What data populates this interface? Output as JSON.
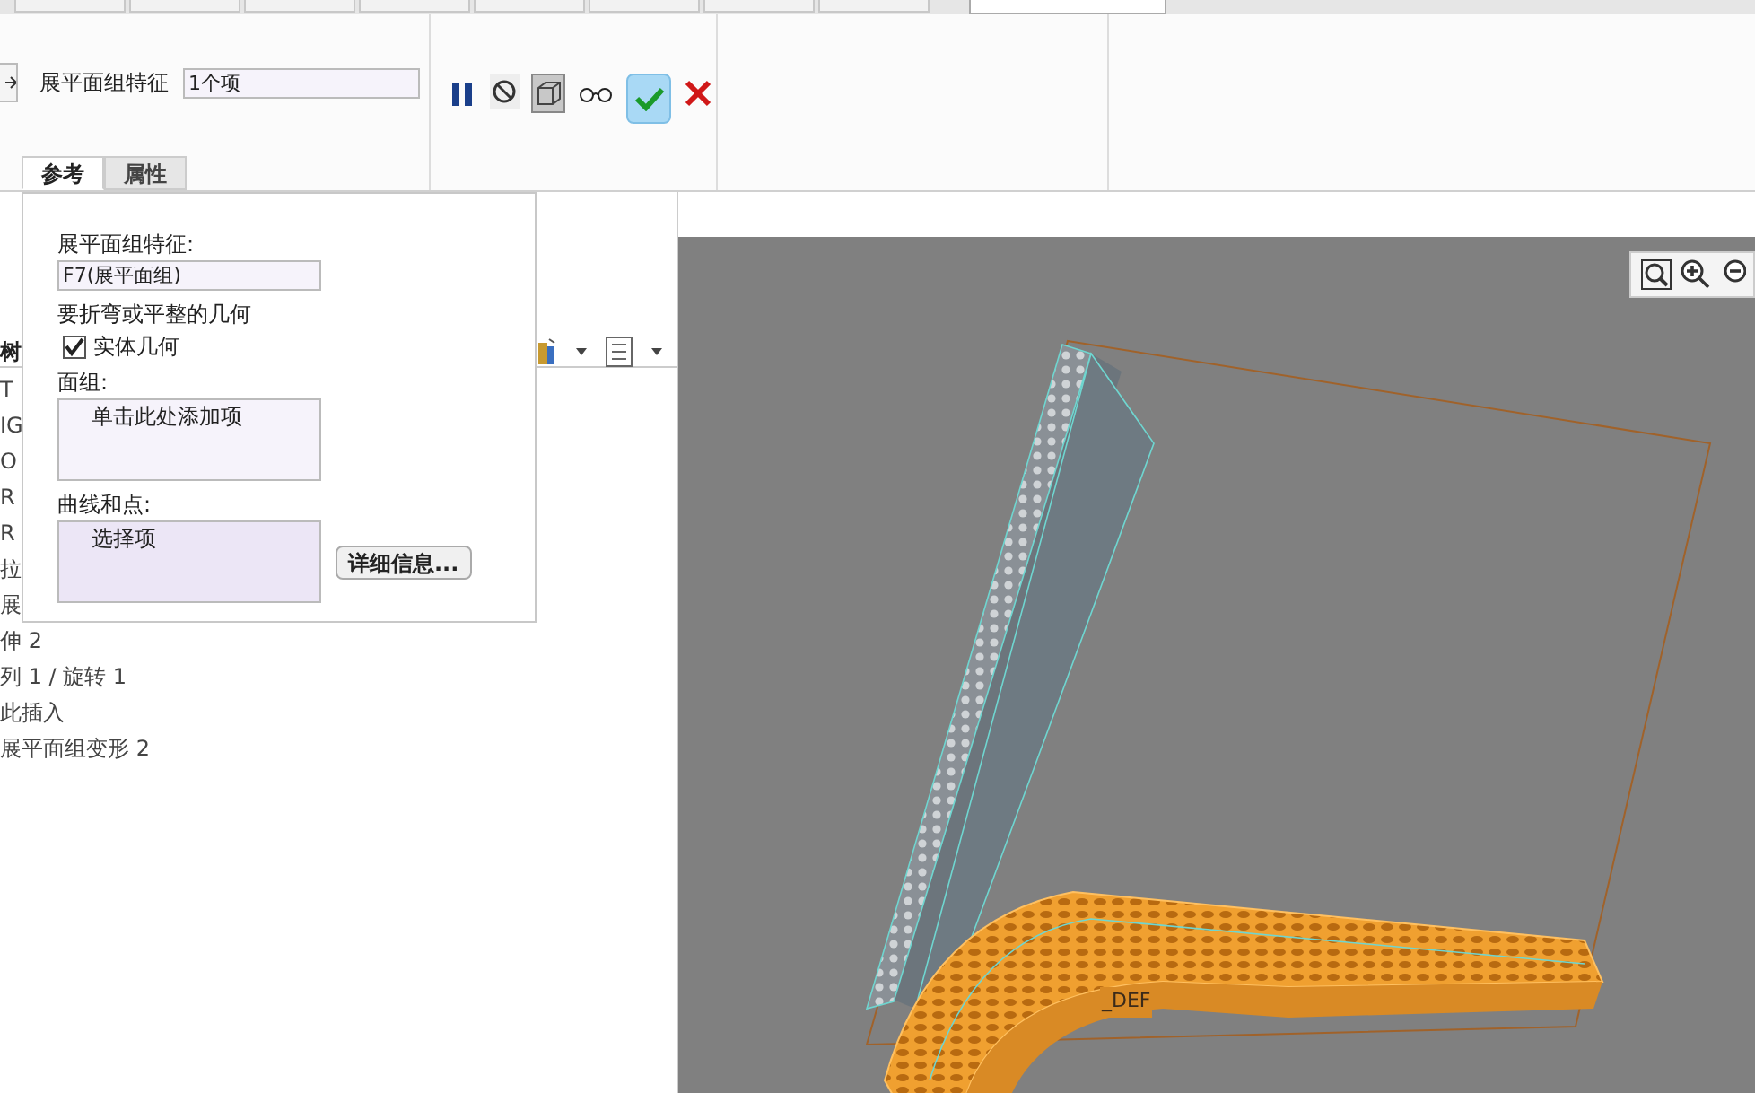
{
  "ribbon_tabs": [
    {
      "selected": false
    },
    {
      "selected": false
    },
    {
      "selected": false
    },
    {
      "selected": false
    },
    {
      "selected": false
    },
    {
      "selected": false
    },
    {
      "selected": false
    },
    {
      "selected": false
    },
    {
      "selected": true
    }
  ],
  "feature_field": {
    "label": "展平面组特征",
    "value": "1个项"
  },
  "tools": [
    {
      "kind": "pause",
      "pressed": false
    },
    {
      "kind": "disable",
      "pressed": false
    },
    {
      "kind": "preview",
      "pressed": true
    },
    {
      "kind": "glasses",
      "pressed": false
    },
    {
      "kind": "ok",
      "pressed": false
    },
    {
      "kind": "cancel",
      "pressed": false
    }
  ],
  "panel_tabs": [
    {
      "label": "参考",
      "selected": true
    },
    {
      "label": "属性",
      "selected": false
    }
  ],
  "references": {
    "feature_label": "展平面组特征:",
    "feature_value": "F7(展平面组)",
    "geometry_label": "要折弯或平整的几何",
    "solid": {
      "label": "实体几何",
      "checked": true
    },
    "quilts_label": "面组:",
    "quilts_placeholder": "单击此处添加项",
    "curves_label": "曲线和点:",
    "curves_placeholder": "选择项",
    "details_button": "详细信息..."
  },
  "tree": {
    "header": "树",
    "items": [
      "T",
      "IG",
      "O",
      "R",
      "R",
      "拉",
      "展",
      "伸 2",
      "列 1 / 旋转 1",
      "此插入",
      "展平面组变形 2"
    ]
  },
  "viewport": {
    "csys_label": "_DEF"
  }
}
